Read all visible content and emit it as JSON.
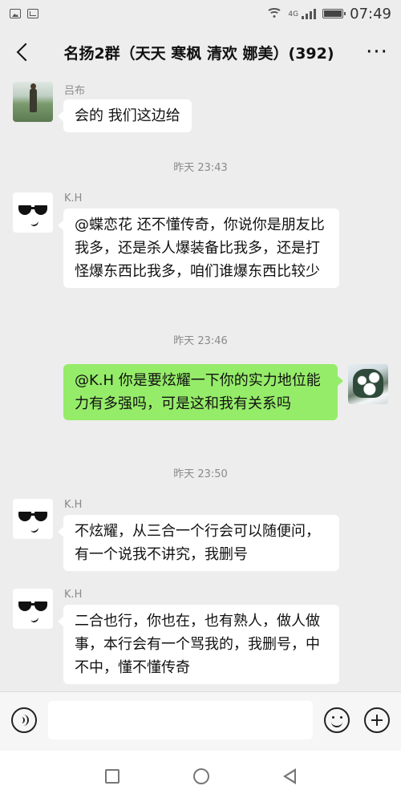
{
  "status_bar": {
    "time": "07:49",
    "network": "4G",
    "icons": [
      "image-icon",
      "gallery-icon",
      "wifi-icon",
      "signal-icon",
      "battery-icon"
    ]
  },
  "header": {
    "title": "名扬2群（天天 寒枫 清欢 娜美）(392)",
    "back_icon": "back-chevron-icon",
    "more_label": "···"
  },
  "messages": [
    {
      "sender": "吕布",
      "text": "会的 我们这边给",
      "side": "left",
      "avatar": "photo-person-icon"
    },
    {
      "time": "昨天 23:43"
    },
    {
      "sender": "K.H",
      "text": "@蝶恋花  还不懂传奇，你说你是朋友比我多，还是杀人爆装备比我多，还是打怪爆东西比我多，咱们谁爆东西比较少",
      "side": "left",
      "avatar": "sunglasses-avatar-icon"
    },
    {
      "time": "昨天 23:46"
    },
    {
      "text": "@K.H 你是要炫耀一下你的实力地位能力有多强吗，可是这和我有关系吗",
      "side": "right",
      "avatar": "photo-snow-tree-icon"
    },
    {
      "time": "昨天 23:50"
    },
    {
      "sender": "K.H",
      "text": "不炫耀，从三合一个行会可以随便问，有一个说我不讲究，我删号",
      "side": "left",
      "avatar": "sunglasses-avatar-icon"
    },
    {
      "sender": "K.H",
      "text": "二合也行，你也在，也有熟人，做人做事，本行会有一个骂我的，我删号，中不中，懂不懂传奇",
      "side": "left",
      "avatar": "sunglasses-avatar-icon"
    }
  ],
  "input_bar": {
    "voice_icon": "voice-icon",
    "text_value": "",
    "emoji_icon": "emoji-icon",
    "plus_icon": "plus-icon"
  },
  "nav_bar": {
    "icons": [
      "recent-apps-icon",
      "home-icon",
      "back-triangle-icon"
    ]
  },
  "colors": {
    "background": "#ededed",
    "bubble_left": "#ffffff",
    "bubble_right": "#95ec69",
    "meta_text": "#8a8a8a"
  }
}
